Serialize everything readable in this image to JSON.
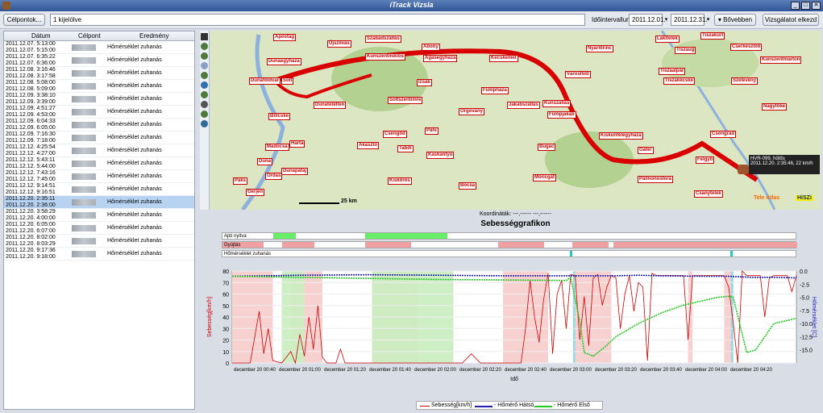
{
  "window": {
    "title": "iTrack Vizsla",
    "minimize": "_",
    "maximize": "□",
    "close": "✕"
  },
  "toolbar": {
    "waypoints_button": "Célpontok...",
    "selection_field": "1 kijelölve",
    "interval_label": "Időintervallum:",
    "date_from": "2011.12.01.",
    "date_to": "2011.12.31.",
    "more_button": "▾ Bővebben",
    "start_button": "Vizsgálatot elkezd"
  },
  "table": {
    "headers": [
      "Dátum",
      "Célpont",
      "Eredmény"
    ],
    "rows": [
      {
        "start": "2011.12.07. 5:13:00",
        "end": "2011.12.07. 5:15:00",
        "result": "Hőmérséklet zuhanás"
      },
      {
        "start": "2011.12.07. 6:35:22",
        "end": "2011.12.07. 6:36:00",
        "result": "Hőmérséklet zuhanás"
      },
      {
        "start": "2011.12.08. 3:16:46",
        "end": "2011.12.08. 3:17:58",
        "result": "Hőmérséklet zuhanás"
      },
      {
        "start": "2011.12.08. 5:08:00",
        "end": "2011.12.08. 5:09:00",
        "result": "Hőmérséklet zuhanás"
      },
      {
        "start": "2011.12.09. 3:38:10",
        "end": "2011.12.09. 3:39:00",
        "result": "Hőmérséklet zuhanás"
      },
      {
        "start": "2011.12.09. 4:51:27",
        "end": "2011.12.09. 4:53:00",
        "result": "Hőmérséklet zuhanás"
      },
      {
        "start": "2011.12.09. 6:04:33",
        "end": "2011.12.09. 6:05:00",
        "result": "Hőmérséklet zuhanás"
      },
      {
        "start": "2011.12.09. 7:16:30",
        "end": "2011.12.09. 7:18:00",
        "result": "Hőmérséklet zuhanás"
      },
      {
        "start": "2011.12.12. 4:25:54",
        "end": "2011.12.12. 4:27:00",
        "result": "Hőmérséklet zuhanás"
      },
      {
        "start": "2011.12.12. 5:43:11",
        "end": "2011.12.12. 5:44:00",
        "result": "Hőmérséklet zuhanás"
      },
      {
        "start": "2011.12.12. 7:43:16",
        "end": "2011.12.12. 7:45:00",
        "result": "Hőmérséklet zuhanás"
      },
      {
        "start": "2011.12.12. 9:14:51",
        "end": "2011.12.12. 9:16:51",
        "result": "Hőmérséklet zuhanás"
      },
      {
        "start": "2011.12.20. 2:35:11",
        "end": "2011.12.20. 2:36:00",
        "result": "Hőmérséklet zuhanás"
      },
      {
        "start": "2011.12.20. 3:58:29",
        "end": "2011.12.20. 4:00:00",
        "result": "Hőmérséklet zuhanás"
      },
      {
        "start": "2011.12.20. 6:05:00",
        "end": "2011.12.20. 6:07:00",
        "result": "Hőmérséklet zuhanás"
      },
      {
        "start": "2011.12.20. 8:02:00",
        "end": "2011.12.20. 8:03:29",
        "result": "Hőmérséklet zuhanás"
      },
      {
        "start": "2011.12.20. 9:17:36",
        "end": "2011.12.20. 9:18:00",
        "result": "Hőmérséklet zuhanás"
      }
    ],
    "selected_row": 12
  },
  "map": {
    "scale": "25 km",
    "vehicle_popup_line1": "HVR-099, hűtős",
    "vehicle_popup_line2": "2011.12.20. 2:35:46, 22 km/h",
    "logo1": "Tele Atlas",
    "logo2": "HiSZi",
    "towns": [
      "Apostag",
      "Újszilvás",
      "Szabadszállás",
      "Kunszentmiklós",
      "Abony",
      "Tiszakürt",
      "Lakitelek",
      "Cserkeszőlő",
      "Dunaegyháza",
      "Ágasegyháza",
      "Kecskemét",
      "Nyárlőrinc",
      "Tiszaug",
      "Kunszentmárton",
      "Dunaföldvár",
      "Solt",
      "Fülöpháza",
      "Városföld",
      "Tiszaalpár",
      "Tiszakécske",
      "Szelevény",
      "Izsák",
      "Kunszállás",
      "Dunatetétlen",
      "Soltszentimre",
      "Orgovány",
      "Jakabszállás",
      "Fülöpjakab",
      "Nagytőke",
      "Bölcske",
      "Csengőd",
      "Páhi",
      "Kiskunfélegyháza",
      "Csongrád",
      "Hartá",
      "Madocsa",
      "Akasztó",
      "Tabdi",
      "Kaskantyú",
      "Bugac",
      "Gátér",
      "Felgyő",
      "Duna",
      "Ordas",
      "Dunapataj",
      "Móricgát",
      "Pálmonostora",
      "Paks",
      "Kiskőrös",
      "Bócsa",
      "Csanytelek",
      "Gerjen"
    ],
    "coord_label": "Koordináták:",
    "coord_value": "---,------     ---,------"
  },
  "chart": {
    "title": "Sebességgrafikon",
    "lane_labels": [
      "Ajtó nyitva",
      "Gyújtás",
      "Hőmérséklet zuhanás"
    ],
    "ylabel_left": "Sebesség[km/h]",
    "ylabel_right": "Hőmérséklet [C]",
    "xlabel": "Idő",
    "legend_speed": "Sebesség[km/h]",
    "legend_rear": "- Hőmérő Hátsó",
    "legend_front": "- Hőmérő Első"
  },
  "chart_data": {
    "type": "line",
    "x_ticks": [
      "december 20 00:40",
      "december 20 01:00",
      "december 20 01:20",
      "december 20 01:40",
      "december 20 02:00",
      "december 20 02:20",
      "december 20 02:40",
      "december 20 03:00",
      "december 20 03:20",
      "december 20 03:40",
      "december 20 04:00",
      "december 20 04:20"
    ],
    "x_range_min": [
      30,
      280
    ],
    "ylim_left": [
      0,
      80
    ],
    "yticks_left": [
      0,
      10,
      20,
      30,
      40,
      50,
      60,
      70,
      80
    ],
    "ylim_right": [
      -17.5,
      0
    ],
    "yticks_right": [
      0.0,
      -2.5,
      -5.0,
      -7.5,
      -10.0,
      -12.5,
      -15.0
    ],
    "series": [
      {
        "name": "Sebesség[km/h]",
        "axis": "left",
        "color": "#cc0000",
        "x": [
          30,
          38,
          42,
          44,
          46,
          48,
          52,
          56,
          58,
          60,
          62,
          64,
          66,
          68,
          70,
          72,
          74,
          76,
          78,
          80,
          84,
          88,
          92,
          96,
          100,
          104,
          108,
          112,
          116,
          120,
          124,
          128,
          132,
          136,
          140,
          144,
          148,
          152,
          156,
          158,
          160,
          162,
          164,
          166,
          168,
          170,
          172,
          174,
          176,
          178,
          180,
          182,
          184,
          186,
          188,
          190,
          192,
          194,
          196,
          198,
          200,
          202,
          204,
          206,
          208,
          210,
          212,
          214,
          216,
          218,
          220,
          222,
          224,
          226,
          228,
          230,
          232,
          234,
          236,
          238,
          240,
          242,
          244,
          246,
          248,
          250,
          252,
          254,
          256,
          258,
          260,
          262,
          264,
          266,
          268,
          270,
          272,
          274,
          276,
          278,
          280
        ],
        "y": [
          0,
          0,
          45,
          8,
          30,
          2,
          0,
          10,
          0,
          25,
          6,
          40,
          12,
          50,
          5,
          0,
          0,
          0,
          12,
          0,
          0,
          0,
          0,
          0,
          0,
          0,
          0,
          0,
          0,
          0,
          0,
          0,
          0,
          8,
          0,
          0,
          0,
          0,
          0,
          0,
          30,
          72,
          40,
          18,
          55,
          78,
          8,
          60,
          72,
          30,
          77,
          76,
          20,
          58,
          15,
          74,
          77,
          50,
          66,
          76,
          74,
          30,
          60,
          76,
          45,
          70,
          66,
          2,
          78,
          76,
          76,
          76,
          76,
          76,
          76,
          76,
          20,
          76,
          76,
          76,
          76,
          76,
          76,
          76,
          76,
          66,
          35,
          0,
          80,
          76,
          76,
          76,
          76,
          40,
          74,
          76,
          76,
          76,
          76,
          62,
          76
        ]
      },
      {
        "name": "Hőmérő Hátsó",
        "axis": "right",
        "color": "#1f1fb4",
        "x": [
          30,
          60,
          90,
          120,
          150,
          180,
          200,
          210,
          220,
          240,
          250,
          255,
          260,
          270,
          280
        ],
        "y": [
          -1.0,
          -0.8,
          -0.7,
          -0.8,
          -0.9,
          -0.9,
          -0.9,
          -0.8,
          -0.9,
          -1.0,
          -1.0,
          -1.1,
          -1.2,
          -1.2,
          -1.3
        ]
      },
      {
        "name": "Hőmérő Első",
        "axis": "right",
        "color": "#22c922",
        "x": [
          30,
          60,
          90,
          120,
          150,
          178,
          180,
          184,
          186,
          190,
          195,
          200,
          210,
          220,
          230,
          240,
          245,
          250,
          252,
          256,
          258,
          262,
          266,
          270,
          275,
          280
        ],
        "y": [
          -1.0,
          -1.2,
          -1.4,
          -1.6,
          -1.7,
          -1.8,
          -1.2,
          -9.5,
          -15.5,
          -16.2,
          -14.5,
          -12.5,
          -10.0,
          -8.0,
          -6.5,
          -5.5,
          -5.0,
          -4.8,
          -5.0,
          -12.0,
          -15.5,
          -15.0,
          -12.5,
          -10.0,
          -9.5,
          -9.0
        ]
      }
    ],
    "bands": {
      "ignition_off": [
        [
          30,
          48
        ],
        [
          56,
          70
        ],
        [
          92,
          112
        ],
        [
          150,
          170
        ],
        [
          182,
          198
        ],
        [
          232,
          234
        ],
        [
          248,
          252
        ]
      ],
      "door_open": [
        [
          52,
          62
        ],
        [
          92,
          128
        ]
      ],
      "temp_drop": [
        [
          181,
          182
        ],
        [
          251,
          252
        ]
      ]
    }
  }
}
